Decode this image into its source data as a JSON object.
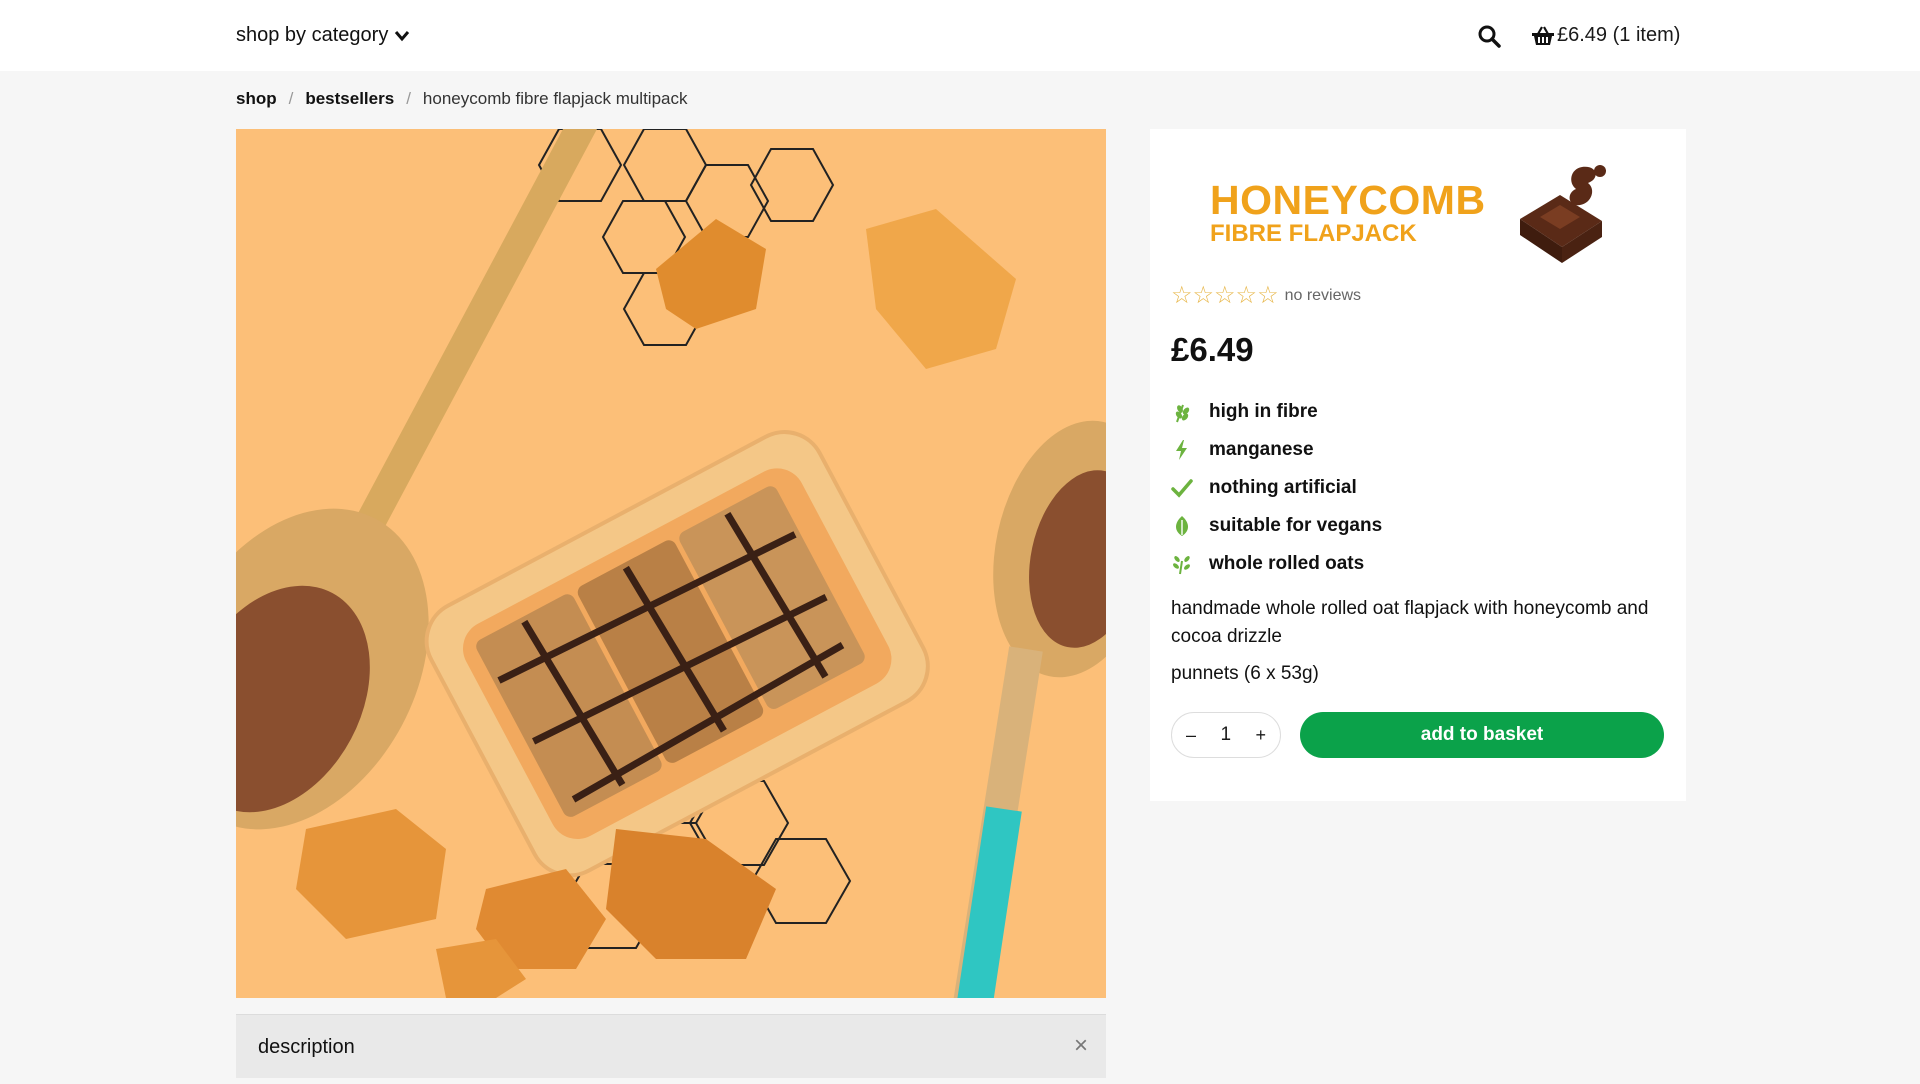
{
  "header": {
    "category_menu": "shop by category",
    "basket": "£6.49 (1 item)"
  },
  "breadcrumb": {
    "items": [
      "shop",
      "bestsellers"
    ],
    "current": "honeycomb fibre flapjack multipack"
  },
  "product": {
    "brand_line1": "HONEYCOMB",
    "brand_line2": "FIBRE FLAPJACK",
    "rating_text": "no reviews",
    "stars": 0,
    "price": "£6.49",
    "features": [
      {
        "label": "high in fibre",
        "icon": "wheat-icon"
      },
      {
        "label": "manganese",
        "icon": "lightning-icon"
      },
      {
        "label": "nothing artificial",
        "icon": "check-icon"
      },
      {
        "label": "suitable for vegans",
        "icon": "leaf-icon"
      },
      {
        "label": "whole rolled oats",
        "icon": "oat-sprig-icon"
      }
    ],
    "description": "handmade whole rolled oat flapjack with honeycomb and cocoa drizzle",
    "pack": "punnets (6 x 53g)",
    "quantity": "1",
    "minus": "–",
    "plus": "+",
    "add_button": "add to basket"
  },
  "accordion": {
    "label": "description",
    "close": "×"
  },
  "colors": {
    "accent_green": "#0ba24a",
    "brand_orange": "#f0a21b",
    "hero_background": "#fcbf78",
    "feature_icon_green": "#6cb33f"
  }
}
